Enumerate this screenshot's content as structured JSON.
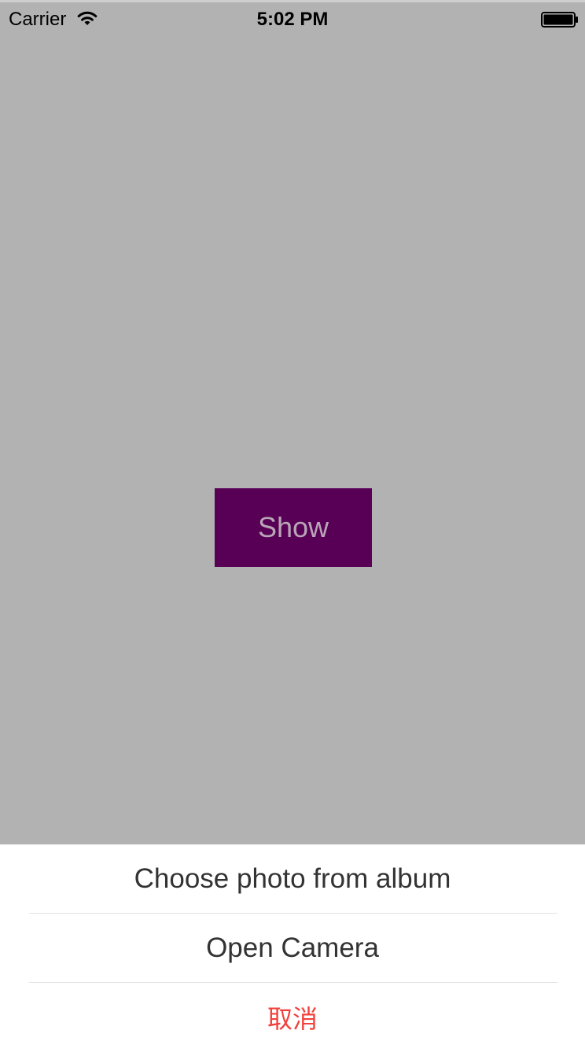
{
  "status_bar": {
    "carrier": "Carrier",
    "time": "5:02 PM",
    "wifi_icon": "wifi-icon",
    "battery_icon": "battery-icon"
  },
  "main": {
    "show_button_label": "Show",
    "show_button_color": "#580056",
    "background_color": "#b2b2b2"
  },
  "action_sheet": {
    "items": [
      {
        "label": "Choose photo from album"
      },
      {
        "label": "Open Camera"
      },
      {
        "label": "取消",
        "color": "#f2403a"
      }
    ]
  }
}
